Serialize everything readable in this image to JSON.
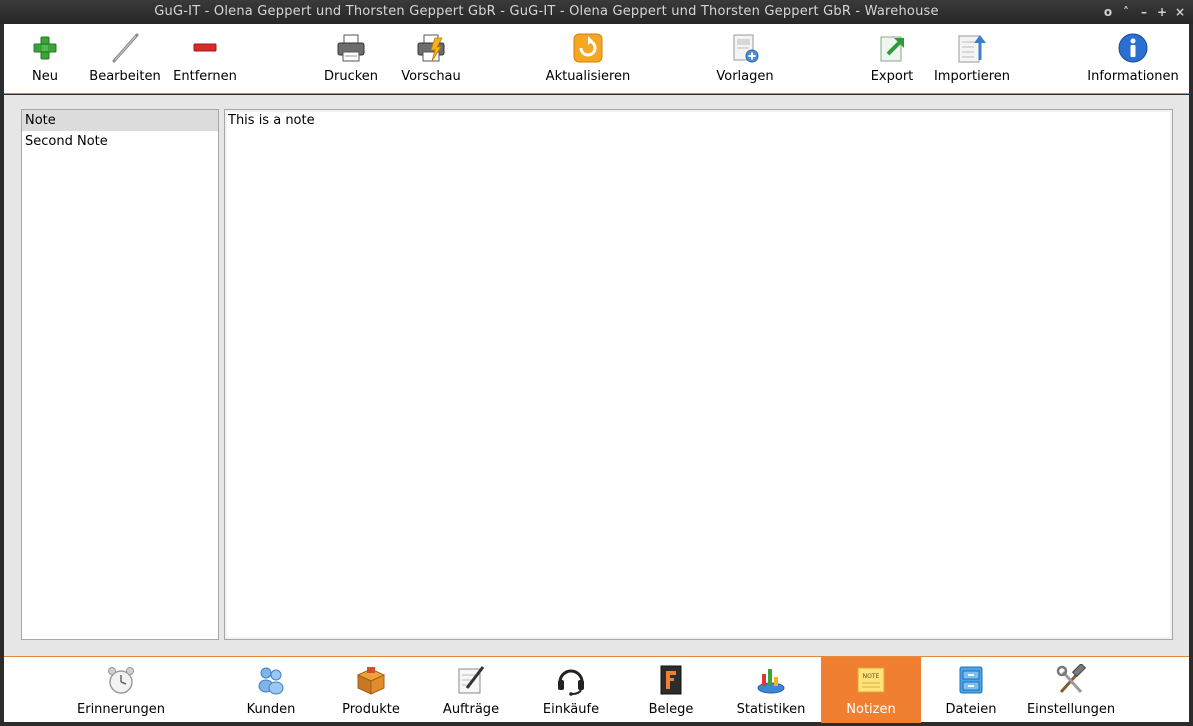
{
  "window": {
    "title": "GuG-IT - Olena Geppert und Thorsten Geppert GbR - GuG-IT - Olena Geppert und Thorsten Geppert GbR - Warehouse",
    "controls": [
      "o",
      "˄",
      "–",
      "+",
      "×"
    ]
  },
  "toolbar": {
    "items": [
      {
        "label": "Neu",
        "icon": "plus-icon"
      },
      {
        "label": "Bearbeiten",
        "icon": "pencil-icon"
      },
      {
        "label": "Entfernen",
        "icon": "minus-icon"
      },
      {
        "label": "Drucken",
        "icon": "printer-icon"
      },
      {
        "label": "Vorschau",
        "icon": "print-preview-icon"
      },
      {
        "label": "Aktualisieren",
        "icon": "refresh-icon"
      },
      {
        "label": "Vorlagen",
        "icon": "template-add-icon"
      },
      {
        "label": "Export",
        "icon": "export-icon"
      },
      {
        "label": "Importieren",
        "icon": "import-icon"
      },
      {
        "label": "Informationen",
        "icon": "info-icon"
      }
    ]
  },
  "notes": {
    "items": [
      {
        "label": "Note",
        "selected": true
      },
      {
        "label": "Second Note",
        "selected": false
      }
    ],
    "content": "This is a note"
  },
  "nav": {
    "active": "Notizen",
    "accent": "#f07f32",
    "items": [
      {
        "label": "Erinnerungen",
        "icon": "alarm-clock-icon"
      },
      {
        "label": "Kunden",
        "icon": "customers-icon"
      },
      {
        "label": "Produkte",
        "icon": "box-icon"
      },
      {
        "label": "Aufträge",
        "icon": "orders-icon"
      },
      {
        "label": "Einkäufe",
        "icon": "headset-icon"
      },
      {
        "label": "Belege",
        "icon": "receipt-icon"
      },
      {
        "label": "Statistiken",
        "icon": "statistics-icon"
      },
      {
        "label": "Notizen",
        "icon": "note-icon"
      },
      {
        "label": "Dateien",
        "icon": "files-icon"
      },
      {
        "label": "Einstellungen",
        "icon": "tools-icon"
      }
    ]
  }
}
